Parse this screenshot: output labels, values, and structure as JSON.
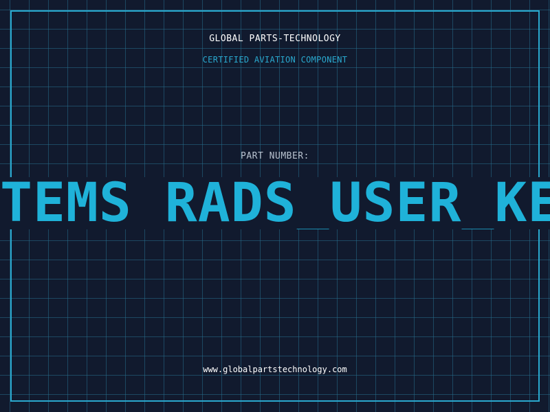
{
  "header": {
    "brand": "GLOBAL PARTS-TECHNOLOGY",
    "subtitle": "CERTIFIED AVIATION COMPONENT"
  },
  "part": {
    "label": "PART NUMBER:",
    "number": "TEMS RADS_USER_KER"
  },
  "footer": {
    "url": "www.globalpartstechnology.com"
  },
  "colors": {
    "background": "#111a2e",
    "grid": "#266e8c",
    "accent": "#2aa9cf",
    "part_number": "#1fb2d9",
    "text_primary": "#ffffff",
    "text_muted": "#b8c2cf"
  }
}
